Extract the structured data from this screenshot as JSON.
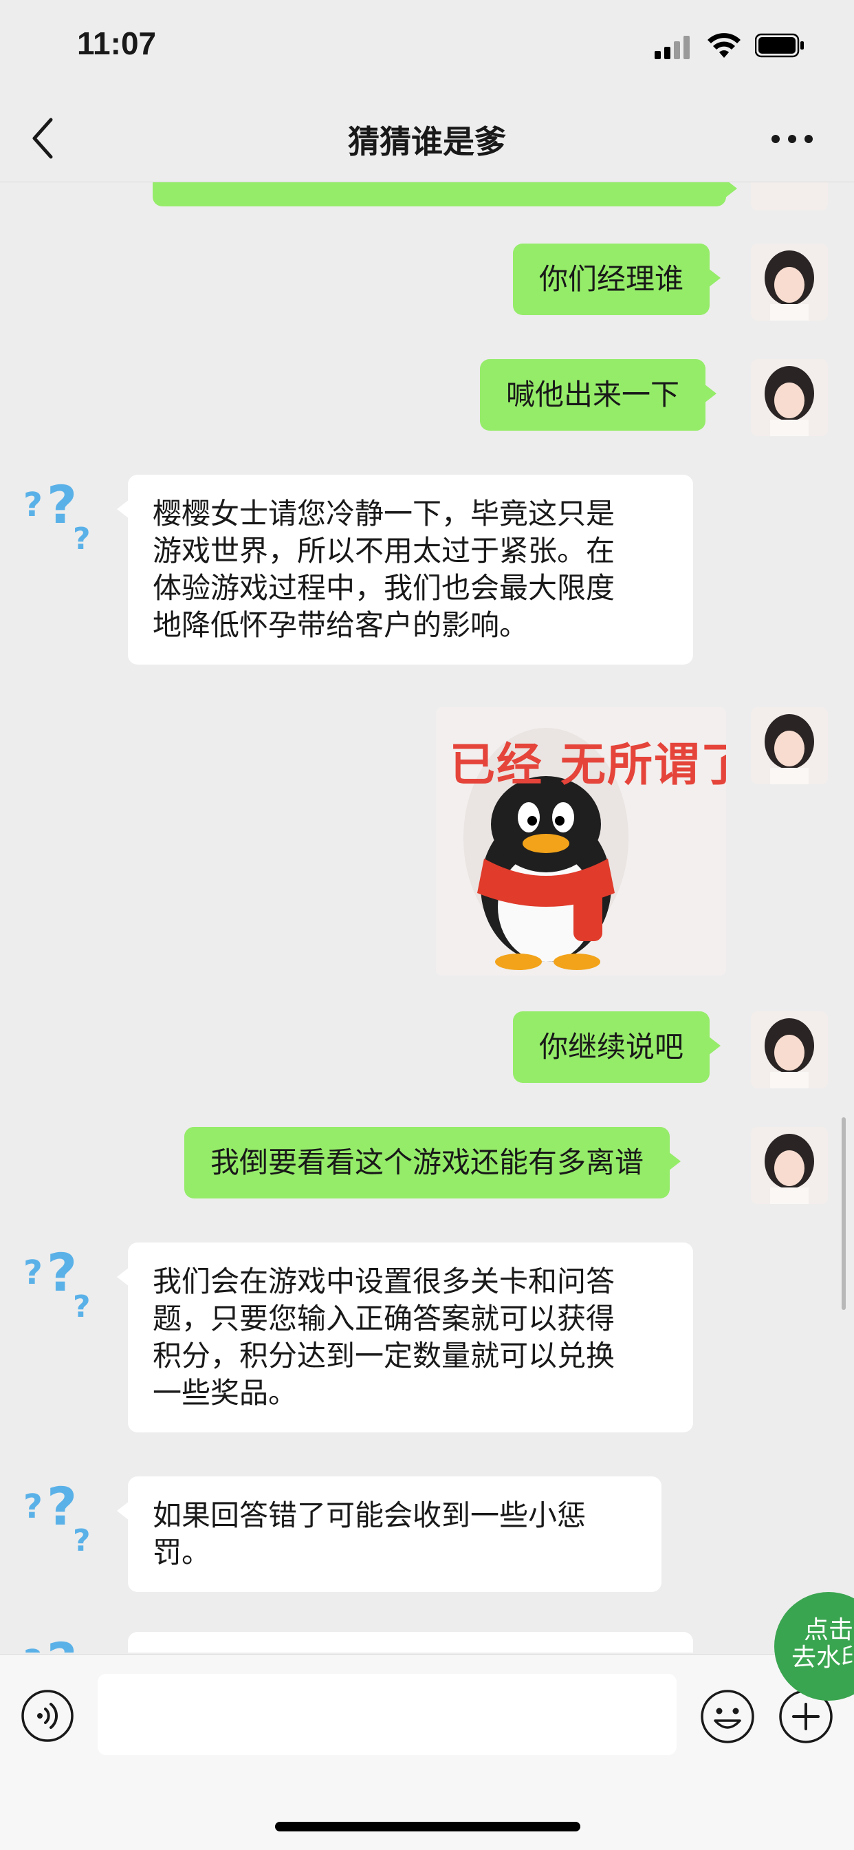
{
  "status_bar": {
    "time": "11:07"
  },
  "nav": {
    "title": "猜猜谁是爹"
  },
  "messages": {
    "m1": "你们经理谁",
    "m2": "喊他出来一下",
    "m3": [
      "樱樱女士请您冷静一下，毕竟这只是",
      "游戏世界，所以不用太过于紧张。在",
      "体验游戏过程中，我们也会最大限度",
      "地降低怀孕带给客户的影响。"
    ],
    "sticker_caption": "已经 无所谓了",
    "m5": "你继续说吧",
    "m6": "我倒要看看这个游戏还能有多离谱",
    "m7": [
      "我们会在游戏中设置很多关卡和问答",
      "题，只要您输入正确答案就可以获得",
      "积分，积分达到一定数量就可以兑换",
      "一些奖品。"
    ],
    "m8": [
      "如果回答错了可能会收到一些小惩",
      "罚。"
    ]
  },
  "fab": {
    "line1": "点击",
    "line2": "去水印"
  },
  "colors": {
    "sent_bubble": "#95ec69",
    "received_bubble": "#ffffff",
    "background": "#ededed",
    "fab": "#3aa550"
  },
  "icons": [
    "back-icon",
    "more-icon",
    "voice-icon",
    "emoji-icon",
    "plus-icon"
  ]
}
